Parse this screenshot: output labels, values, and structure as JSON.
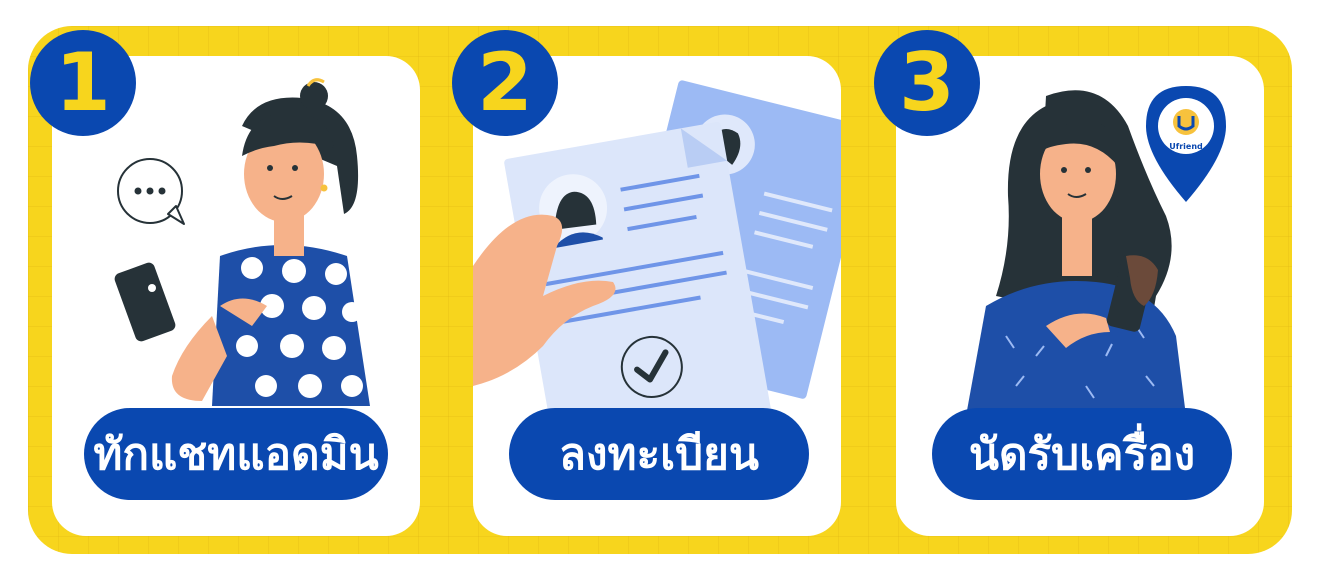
{
  "brand": {
    "name": "Ufriend",
    "accent": "#0a48b0",
    "background": "#f7d51d"
  },
  "steps": [
    {
      "number": "1",
      "label": "ทักแชทแอดมิน",
      "illustration": "woman-using-phone-with-chat-bubble"
    },
    {
      "number": "2",
      "label": "ลงทะเบียน",
      "illustration": "hand-holding-documents-with-checkmark"
    },
    {
      "number": "3",
      "label": "นัดรับเครื่อง",
      "illustration": "woman-holding-phone-with-location-pin"
    }
  ]
}
